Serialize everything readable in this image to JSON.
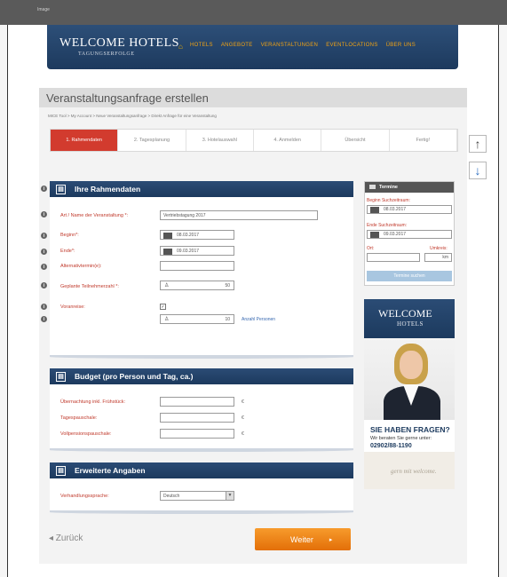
{
  "window": {
    "tab_label": "Image"
  },
  "header": {
    "logo_main": "WELCOME HOTELS",
    "logo_sub": "TAGUNGSERFOLGE",
    "nav": [
      "HOTELS",
      "ANGEBOTE",
      "VERANSTALTUNGEN",
      "EVENTLOCATIONS",
      "ÜBER UNS"
    ]
  },
  "page": {
    "title": "Veranstaltungsanfrage erstellen",
    "breadcrumb": "MICE Tool > My Account > Neue Veranstaltungsanfrage > Direkt Anfrage für eine Veranstaltung"
  },
  "steps": [
    "1. Rahmendaten",
    "2. Tagesplanung",
    "3. Hotelauswahl",
    "4. Anmelden",
    "Übersicht",
    "Fertig!"
  ],
  "rahmendaten": {
    "title": "Ihre Rahmendaten",
    "fields": [
      {
        "label": "Art / Name der Veranstaltung *:",
        "value": "Vertriebstagung 2017"
      },
      {
        "label": "Beginn*:",
        "value": "08.03.2017"
      },
      {
        "label": "Ende*:",
        "value": "09.03.2017"
      },
      {
        "label": "Alternativtermin(e):",
        "value": ""
      },
      {
        "label": "Geplante Teilnehmerzahl *:",
        "value": "50"
      },
      {
        "label": "Voranreise:",
        "value": "✓"
      },
      {
        "label": "",
        "value": "10",
        "note": "Anzahl Personen"
      }
    ]
  },
  "budget": {
    "title": "Budget (pro Person und Tag, ca.)",
    "fields": [
      {
        "label": "Übernachtung inkl. Frühstück:",
        "value": "",
        "unit": "€"
      },
      {
        "label": "Tagespauschale:",
        "value": "",
        "unit": "€"
      },
      {
        "label": "Vollpensionspauschale:",
        "value": "",
        "unit": "€"
      }
    ]
  },
  "erweitert": {
    "title": "Erweiterte Angaben",
    "label": "Verhandlungssprache:",
    "value": "Deutsch"
  },
  "termine": {
    "title": "Termine",
    "beginn_label": "Beginn Suchzeitraum:",
    "beginn_value": "08.03.2017",
    "ende_label": "Ende Suchzeitraum:",
    "ende_value": "09.03.2017",
    "ort_label": "Ort:",
    "umkreis_label": "Umkreis:",
    "umkreis_unit": "km",
    "button": "Termine suchen"
  },
  "ad": {
    "logo_main": "WELCOME",
    "logo_sub": "HOTELS",
    "question": "SIE HABEN FRAGEN?",
    "text": "Wir beraten Sie gerne unter:",
    "phone": "02902/88-1190",
    "signature": "gern mit welcome."
  },
  "nav_buttons": {
    "back": "◂ Zurück",
    "next": "Weiter",
    "next_arrow": "▸"
  }
}
